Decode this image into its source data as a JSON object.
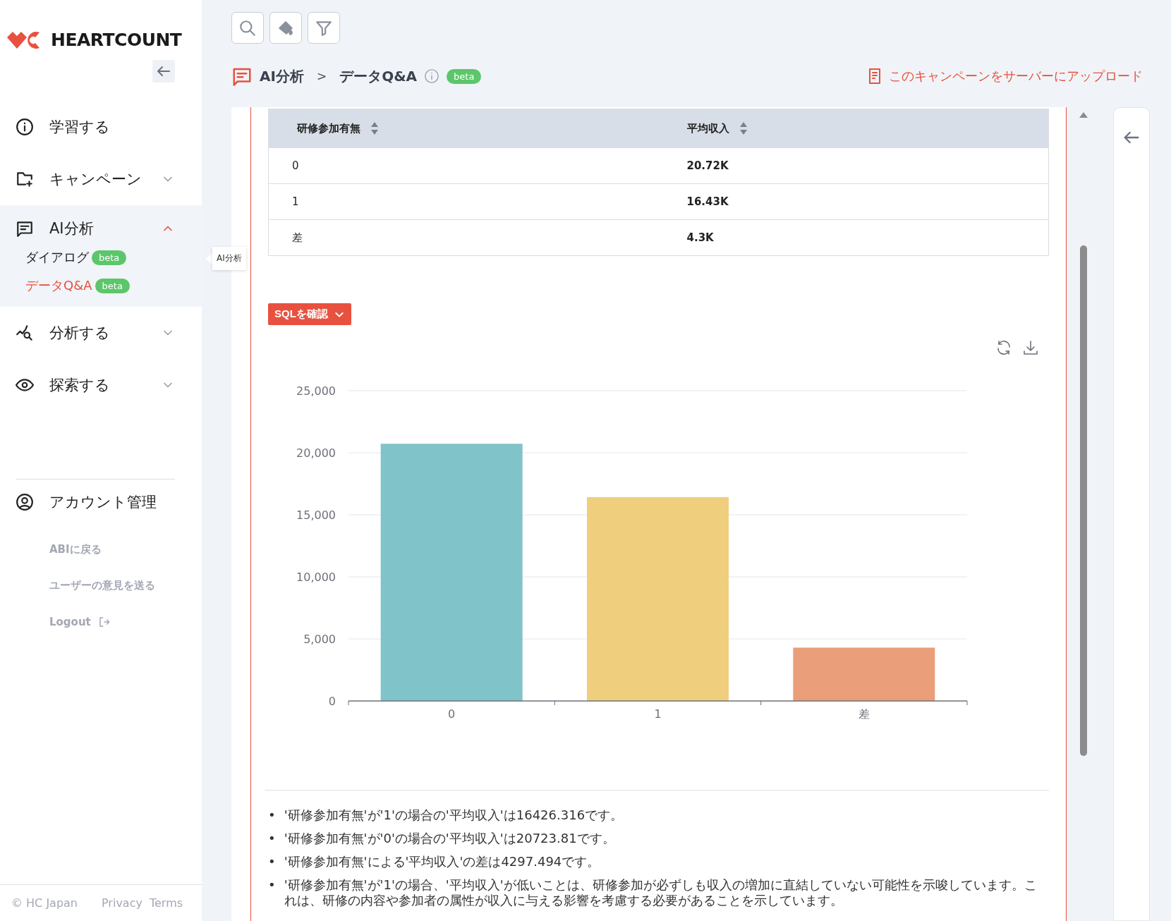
{
  "logo": {
    "text": "HEARTCOUNT"
  },
  "sidebar": {
    "items": [
      {
        "label": "学習する"
      },
      {
        "label": "キャンペーン",
        "expanded": false
      },
      {
        "label": "AI分析",
        "expanded": true,
        "children": [
          {
            "label": "ダイアログ",
            "badge": "beta",
            "selected": false
          },
          {
            "label": "データQ&A",
            "badge": "beta",
            "selected": true
          }
        ]
      },
      {
        "label": "分析する",
        "expanded": false
      },
      {
        "label": "探索する",
        "expanded": false
      }
    ],
    "account": {
      "label": "アカウント管理"
    },
    "links": [
      {
        "label": "ABIに戻る"
      },
      {
        "label": "ユーザーの意見を送る"
      },
      {
        "label": "Logout",
        "kind": "logout"
      }
    ],
    "footer": {
      "copyright": "© HC Japan",
      "links": [
        "Privacy",
        "Terms"
      ]
    }
  },
  "tooltip": "AI分析",
  "breadcrumb": {
    "items": [
      "AI分析",
      "データQ&A"
    ],
    "separator": ">",
    "badge": "beta"
  },
  "upload_link": "このキャンペーンをサーバーにアップロード",
  "table": {
    "columns": [
      "研修参加有無",
      "平均収入"
    ],
    "rows": [
      [
        "0",
        "20.72K"
      ],
      [
        "1",
        "16.43K"
      ],
      [
        "差",
        "4.3K"
      ]
    ]
  },
  "sql_button": "SQLを確認",
  "chart_data": {
    "type": "bar",
    "grid": true,
    "categories": [
      "0",
      "1",
      "差"
    ],
    "values": [
      20723.81,
      16426.316,
      4297.494
    ],
    "colors": [
      "#80c3c9",
      "#efcf7e",
      "#ea9e7a"
    ],
    "ylim": [
      0,
      25000
    ],
    "yticks": [
      {
        "value": 0,
        "label": "0"
      },
      {
        "value": 5000,
        "label": "5,000"
      },
      {
        "value": 10000,
        "label": "10,000"
      },
      {
        "value": 15000,
        "label": "15,000"
      },
      {
        "value": 20000,
        "label": "20,000"
      },
      {
        "value": 25000,
        "label": "25,000"
      }
    ]
  },
  "summary_marker": "•",
  "summary": [
    "'研修参加有無'が'1'の場合の'平均収入'は16426.316です。",
    "'研修参加有無'が'0'の場合の'平均収入'は20723.81です。",
    "'研修参加有無'による'平均収入'の差は4297.494です。",
    "'研修参加有無'が'1'の場合、'平均収入'が低いことは、研修参加が必ずしも収入の増加に直結していない可能性を示唆しています。これは、研修の内容や参加者の属性が収入に与える影響を考慮する必要があることを示しています。"
  ]
}
